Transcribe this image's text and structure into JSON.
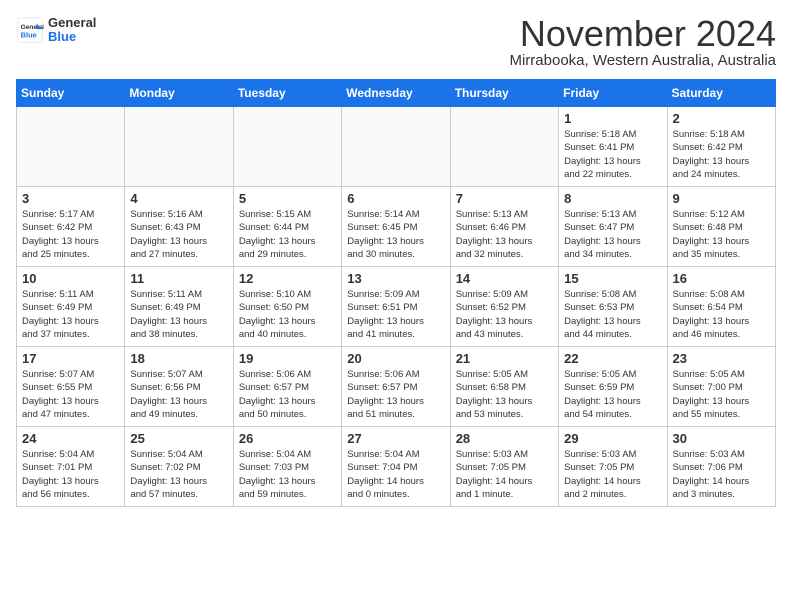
{
  "header": {
    "logo_general": "General",
    "logo_blue": "Blue",
    "month_title": "November 2024",
    "location": "Mirrabooka, Western Australia, Australia"
  },
  "weekdays": [
    "Sunday",
    "Monday",
    "Tuesday",
    "Wednesday",
    "Thursday",
    "Friday",
    "Saturday"
  ],
  "weeks": [
    [
      {
        "day": "",
        "info": ""
      },
      {
        "day": "",
        "info": ""
      },
      {
        "day": "",
        "info": ""
      },
      {
        "day": "",
        "info": ""
      },
      {
        "day": "",
        "info": ""
      },
      {
        "day": "1",
        "info": "Sunrise: 5:18 AM\nSunset: 6:41 PM\nDaylight: 13 hours\nand 22 minutes."
      },
      {
        "day": "2",
        "info": "Sunrise: 5:18 AM\nSunset: 6:42 PM\nDaylight: 13 hours\nand 24 minutes."
      }
    ],
    [
      {
        "day": "3",
        "info": "Sunrise: 5:17 AM\nSunset: 6:42 PM\nDaylight: 13 hours\nand 25 minutes."
      },
      {
        "day": "4",
        "info": "Sunrise: 5:16 AM\nSunset: 6:43 PM\nDaylight: 13 hours\nand 27 minutes."
      },
      {
        "day": "5",
        "info": "Sunrise: 5:15 AM\nSunset: 6:44 PM\nDaylight: 13 hours\nand 29 minutes."
      },
      {
        "day": "6",
        "info": "Sunrise: 5:14 AM\nSunset: 6:45 PM\nDaylight: 13 hours\nand 30 minutes."
      },
      {
        "day": "7",
        "info": "Sunrise: 5:13 AM\nSunset: 6:46 PM\nDaylight: 13 hours\nand 32 minutes."
      },
      {
        "day": "8",
        "info": "Sunrise: 5:13 AM\nSunset: 6:47 PM\nDaylight: 13 hours\nand 34 minutes."
      },
      {
        "day": "9",
        "info": "Sunrise: 5:12 AM\nSunset: 6:48 PM\nDaylight: 13 hours\nand 35 minutes."
      }
    ],
    [
      {
        "day": "10",
        "info": "Sunrise: 5:11 AM\nSunset: 6:49 PM\nDaylight: 13 hours\nand 37 minutes."
      },
      {
        "day": "11",
        "info": "Sunrise: 5:11 AM\nSunset: 6:49 PM\nDaylight: 13 hours\nand 38 minutes."
      },
      {
        "day": "12",
        "info": "Sunrise: 5:10 AM\nSunset: 6:50 PM\nDaylight: 13 hours\nand 40 minutes."
      },
      {
        "day": "13",
        "info": "Sunrise: 5:09 AM\nSunset: 6:51 PM\nDaylight: 13 hours\nand 41 minutes."
      },
      {
        "day": "14",
        "info": "Sunrise: 5:09 AM\nSunset: 6:52 PM\nDaylight: 13 hours\nand 43 minutes."
      },
      {
        "day": "15",
        "info": "Sunrise: 5:08 AM\nSunset: 6:53 PM\nDaylight: 13 hours\nand 44 minutes."
      },
      {
        "day": "16",
        "info": "Sunrise: 5:08 AM\nSunset: 6:54 PM\nDaylight: 13 hours\nand 46 minutes."
      }
    ],
    [
      {
        "day": "17",
        "info": "Sunrise: 5:07 AM\nSunset: 6:55 PM\nDaylight: 13 hours\nand 47 minutes."
      },
      {
        "day": "18",
        "info": "Sunrise: 5:07 AM\nSunset: 6:56 PM\nDaylight: 13 hours\nand 49 minutes."
      },
      {
        "day": "19",
        "info": "Sunrise: 5:06 AM\nSunset: 6:57 PM\nDaylight: 13 hours\nand 50 minutes."
      },
      {
        "day": "20",
        "info": "Sunrise: 5:06 AM\nSunset: 6:57 PM\nDaylight: 13 hours\nand 51 minutes."
      },
      {
        "day": "21",
        "info": "Sunrise: 5:05 AM\nSunset: 6:58 PM\nDaylight: 13 hours\nand 53 minutes."
      },
      {
        "day": "22",
        "info": "Sunrise: 5:05 AM\nSunset: 6:59 PM\nDaylight: 13 hours\nand 54 minutes."
      },
      {
        "day": "23",
        "info": "Sunrise: 5:05 AM\nSunset: 7:00 PM\nDaylight: 13 hours\nand 55 minutes."
      }
    ],
    [
      {
        "day": "24",
        "info": "Sunrise: 5:04 AM\nSunset: 7:01 PM\nDaylight: 13 hours\nand 56 minutes."
      },
      {
        "day": "25",
        "info": "Sunrise: 5:04 AM\nSunset: 7:02 PM\nDaylight: 13 hours\nand 57 minutes."
      },
      {
        "day": "26",
        "info": "Sunrise: 5:04 AM\nSunset: 7:03 PM\nDaylight: 13 hours\nand 59 minutes."
      },
      {
        "day": "27",
        "info": "Sunrise: 5:04 AM\nSunset: 7:04 PM\nDaylight: 14 hours\nand 0 minutes."
      },
      {
        "day": "28",
        "info": "Sunrise: 5:03 AM\nSunset: 7:05 PM\nDaylight: 14 hours\nand 1 minute."
      },
      {
        "day": "29",
        "info": "Sunrise: 5:03 AM\nSunset: 7:05 PM\nDaylight: 14 hours\nand 2 minutes."
      },
      {
        "day": "30",
        "info": "Sunrise: 5:03 AM\nSunset: 7:06 PM\nDaylight: 14 hours\nand 3 minutes."
      }
    ]
  ]
}
